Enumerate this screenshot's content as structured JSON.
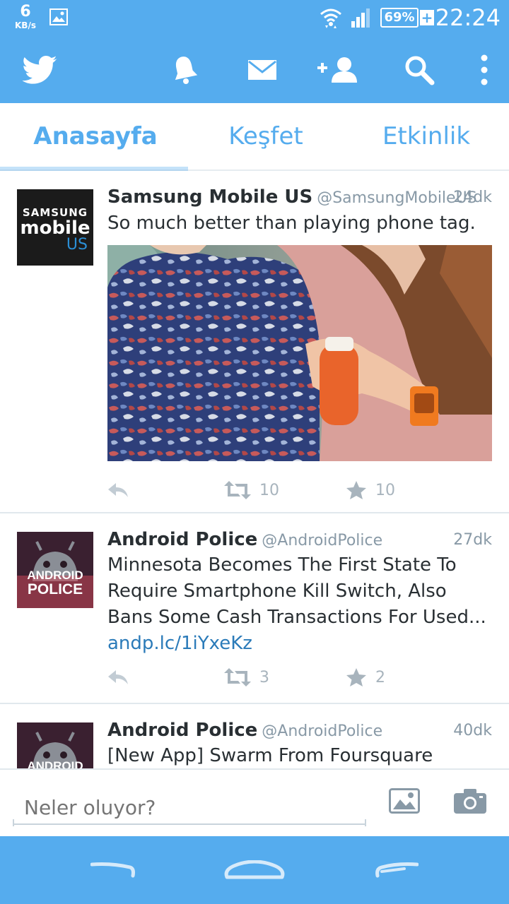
{
  "status_bar": {
    "net_speed_value": "6",
    "net_speed_unit": "KB/s",
    "battery_percent": "69%",
    "charging_symbol": "+",
    "clock": "22:24",
    "icons": [
      "gallery-icon",
      "wifi-icon",
      "signal-icon",
      "battery-icon"
    ]
  },
  "action_bar": {
    "icons": [
      "twitter-bird-icon",
      "bell-icon",
      "mail-icon",
      "add-user-icon",
      "search-icon",
      "overflow-menu-icon"
    ],
    "accent_color": "#55acee"
  },
  "tabs": [
    {
      "label": "Anasayfa",
      "active": true
    },
    {
      "label": "Keşfet",
      "active": false
    },
    {
      "label": "Etkinlik",
      "active": false
    }
  ],
  "tweets": [
    {
      "avatar_text": {
        "line1": "SAMSUNG",
        "line2": "mobile",
        "line3": "US"
      },
      "name": "Samsung Mobile US",
      "handle": "@SamsungMobileUS",
      "time": "24dk",
      "text": "So much better than playing phone tag.",
      "link": "",
      "has_photo": true,
      "retweets": "10",
      "favorites": "10"
    },
    {
      "avatar_text": {
        "line1": "ANDROID",
        "line2": "POLICE"
      },
      "name": "Android Police",
      "handle": "@AndroidPolice",
      "time": "27dk",
      "text": "Minnesota Becomes The First State To Require Smartphone Kill Switch, Also Bans Some Cash Transactions For Used...",
      "link": "andp.lc/1iYxeKz",
      "has_photo": false,
      "retweets": "3",
      "favorites": "2"
    },
    {
      "avatar_text": {
        "line1": "ANDROID"
      },
      "name": "Android Police",
      "handle": "@AndroidPolice",
      "time": "40dk",
      "text": "[New App] Swarm From Foursquare Really",
      "link": "",
      "has_photo": false
    }
  ],
  "composer": {
    "placeholder": "Neler oluyor?",
    "icons": [
      "image-icon",
      "camera-icon"
    ]
  },
  "nav_bar": {
    "icons": [
      "back-icon",
      "home-icon",
      "recents-icon"
    ]
  }
}
